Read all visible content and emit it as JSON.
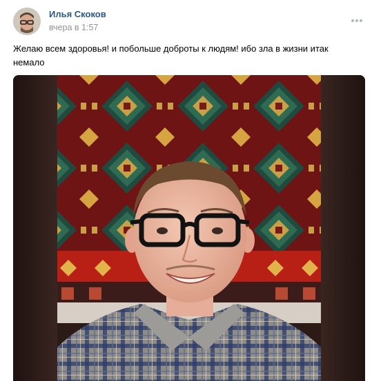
{
  "post": {
    "author_name": "Илья Скоков",
    "timestamp": "вчера в 1:57",
    "body_text": "Желаю всем здоровья! и побольше доброты к людям! ибо зла в жизни итак немало",
    "more_icon": "more-horizontal-icon",
    "avatar_icon": "user-avatar"
  },
  "colors": {
    "author_link": "#2a5885",
    "meta_gray": "#939393",
    "photo_border": "#2b1a16"
  }
}
